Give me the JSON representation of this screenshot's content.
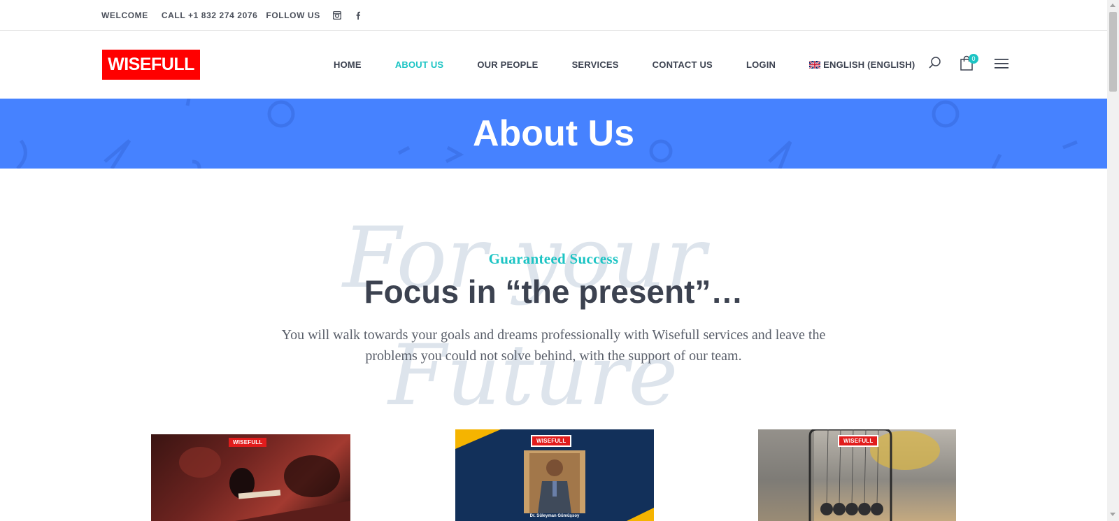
{
  "topbar": {
    "welcome": "WELCOME",
    "call": "CALL +1 832 274 2076",
    "follow": "FOLLOW US",
    "icons": [
      "instagram-icon",
      "facebook-icon"
    ]
  },
  "header": {
    "logo": "WISEFULL",
    "nav": [
      {
        "label": "HOME",
        "active": false
      },
      {
        "label": "ABOUT US",
        "active": true
      },
      {
        "label": "OUR PEOPLE",
        "active": false
      },
      {
        "label": "SERVICES",
        "active": false
      },
      {
        "label": "CONTACT US",
        "active": false
      },
      {
        "label": "LOGIN",
        "active": false
      },
      {
        "label": "ENGLISH (ENGLISH)",
        "active": false
      }
    ],
    "cart_count": "0",
    "accent_color": "#1cc4c4"
  },
  "hero": {
    "title": "About Us",
    "background": "#4682ff"
  },
  "intro": {
    "script_line1": "For your",
    "script_line2": "Future",
    "eyebrow": "Guaranteed Success",
    "headline": "Focus in “the present”…",
    "description": "You will walk towards your goals and dreams professionally with Wisefull services and leave the problems you could not solve behind, with the support of our team."
  },
  "cards": [
    {
      "badge": "WISEFULL"
    },
    {
      "badge": "WISEFULL",
      "caption": "Dr. Süleyman Gümüşsoy"
    },
    {
      "badge": "WISEFULL"
    }
  ]
}
